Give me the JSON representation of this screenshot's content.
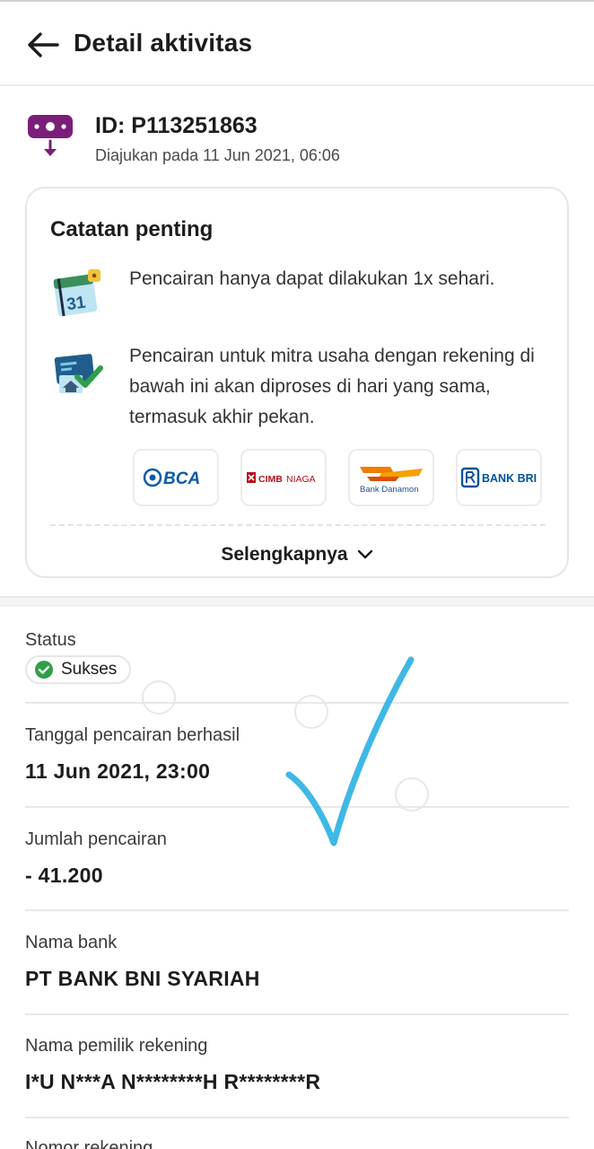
{
  "header": {
    "title": "Detail aktivitas"
  },
  "activity": {
    "id_label": "ID: P113251863",
    "submitted": "Diajukan pada 11 Jun 2021, 06:06"
  },
  "notes": {
    "title": "Catatan penting",
    "items": [
      {
        "icon": "calendar-icon",
        "text": "Pencairan hanya dapat dilakukan 1x sehari."
      },
      {
        "icon": "bank-transfer-check-icon",
        "text": "Pencairan untuk mitra usaha dengan rekening di bawah ini akan diproses di hari yang sama, termasuk akhir pekan."
      }
    ],
    "banks": [
      {
        "name": "BCA",
        "color": "#0a5aa8"
      },
      {
        "name": "CIMB NIAGA",
        "color": "#b40d1e"
      },
      {
        "name": "Bank Danamon",
        "color": "#f07d00"
      },
      {
        "name": "BANK BRI",
        "color": "#00529c"
      }
    ],
    "more_label": "Selengkapnya"
  },
  "details": {
    "status_label": "Status",
    "status_value": "Sukses",
    "date_label": "Tanggal pencairan berhasil",
    "date_value": "11 Jun 2021, 23:00",
    "amount_label": "Jumlah pencairan",
    "amount_value": "- 41.200",
    "bank_label": "Nama bank",
    "bank_value": "PT BANK BNI SYARIAH",
    "owner_label": "Nama pemilik rekening",
    "owner_value": "I*U N***A N********H R********R",
    "account_label": "Nomor rekening"
  },
  "colors": {
    "brand_purple": "#7b1e7a",
    "success_green": "#2e9e48",
    "annotation_blue": "#3fb8e6"
  }
}
